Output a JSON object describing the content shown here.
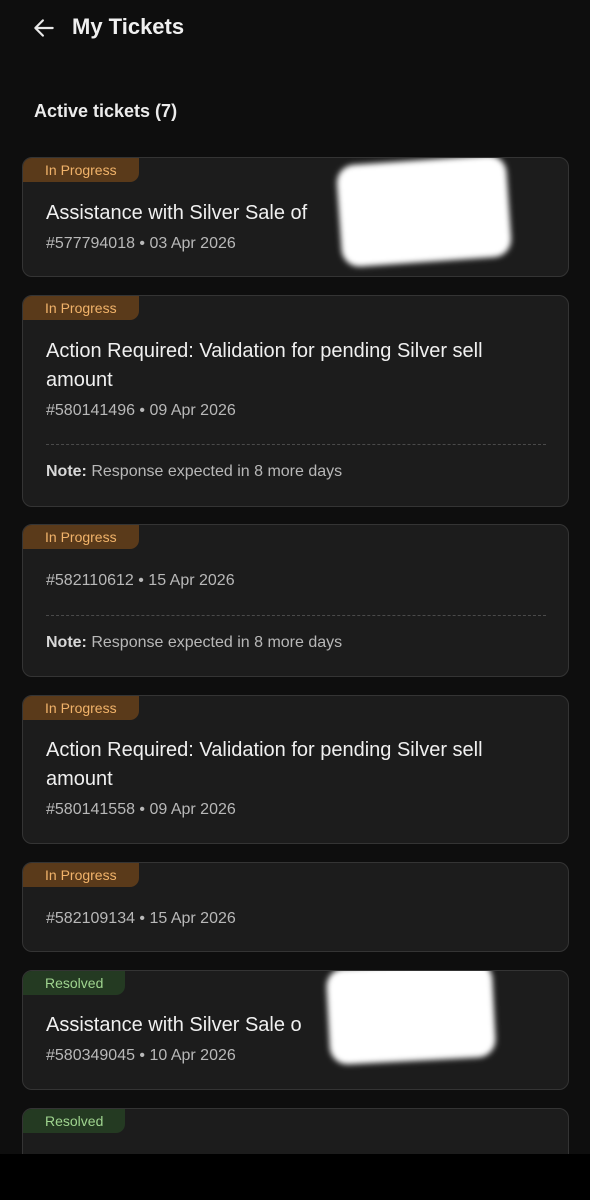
{
  "header": {
    "title": "My Tickets",
    "back_icon": "arrow-left-icon"
  },
  "section": {
    "title": "Active tickets (7)"
  },
  "status_colors": {
    "in_progress_bg": "#5a3a1a",
    "in_progress_text": "#f1b36a",
    "resolved_bg": "#243a22",
    "resolved_text": "#9fd48f"
  },
  "tickets": [
    {
      "status": "In Progress",
      "title": "Assistance with Silver Sale of",
      "id": "#577794018",
      "date": "03 Apr 2026",
      "meta": "#577794018 • 03 Apr 2026"
    },
    {
      "status": "In Progress",
      "title": "Action Required: Validation for pending Silver sell amount",
      "id": "#580141496",
      "date": "09 Apr 2026",
      "meta": "#580141496 • 09 Apr 2026",
      "note_label": "Note:",
      "note_text": " Response expected in 8 more days"
    },
    {
      "status": "In Progress",
      "id": "#582110612",
      "date": "15 Apr 2026",
      "meta": "#582110612 • 15 Apr 2026",
      "note_label": "Note:",
      "note_text": " Response expected in 8 more days"
    },
    {
      "status": "In Progress",
      "title": "Action Required: Validation for pending Silver sell amount",
      "id": "#580141558",
      "date": "09 Apr 2026",
      "meta": "#580141558 • 09 Apr 2026"
    },
    {
      "status": "In Progress",
      "id": "#582109134",
      "date": "15 Apr 2026",
      "meta": "#582109134 • 15 Apr 2026"
    },
    {
      "status": "Resolved",
      "title": "Assistance with Silver Sale o",
      "id": "#580349045",
      "date": "10 Apr 2026",
      "meta": "#580349045 • 10 Apr 2026"
    },
    {
      "status": "Resolved"
    }
  ]
}
